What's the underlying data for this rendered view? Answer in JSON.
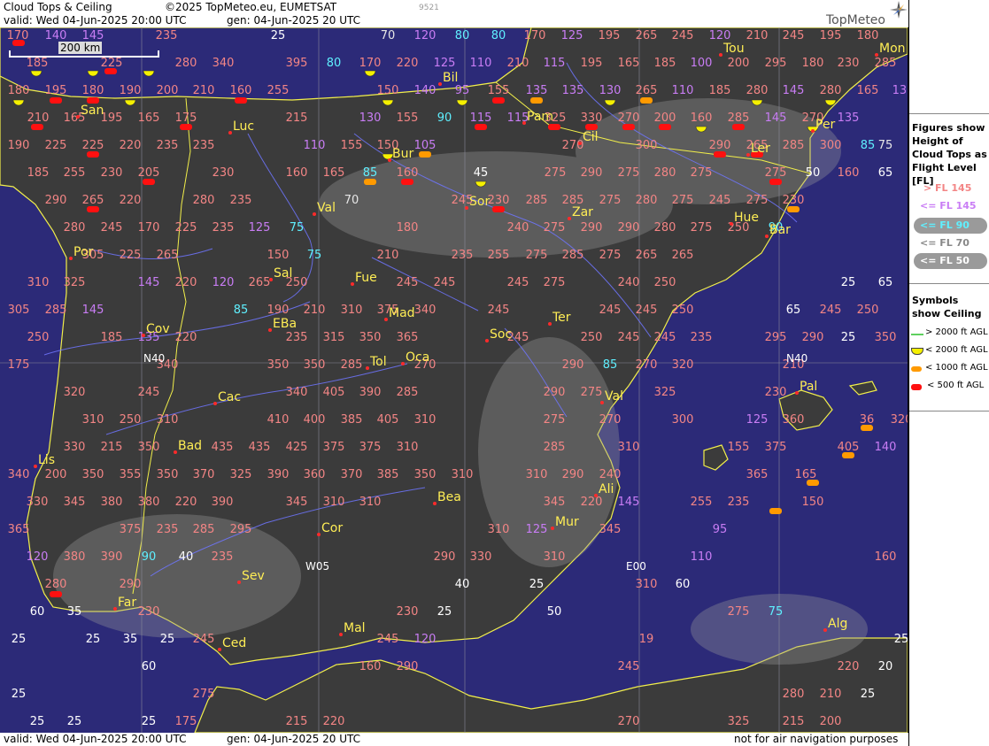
{
  "header": {
    "title": "Cloud Tops & Ceiling",
    "copyright": "©2025 TopMeteo.eu, EUMETSAT",
    "valid": "valid:  Wed  04-Jun-2025  20:00 UTC",
    "generated": "gen: 04-Jun-2025 20 UTC",
    "code": "9521",
    "logo": "TopMeteo"
  },
  "footer": {
    "valid": "valid:  Wed  04-Jun-2025  20:00 UTC",
    "generated": "gen: 04-Jun-2025 20 UTC",
    "disclaimer": "not for air navigation purposes"
  },
  "scale_label": "200 km",
  "legend": {
    "figures_title": "Figures show Height of Cloud Tops as Flight Level  [FL]",
    "figure_items": [
      "> FL 145",
      "<= FL 145",
      "<= FL 90",
      "<= FL 70",
      "<= FL 50"
    ],
    "symbols_title": "Symbols show Ceiling",
    "symbol_items": [
      "> 2000 ft AGL",
      "< 2000 ft AGL",
      "< 1000 ft AGL",
      "< 500 ft AGL"
    ]
  },
  "colors": {
    "sea": "#2c2a78",
    "land": "#3b3b3b",
    "coast": "#f2ef4a",
    "river": "#6f75ff",
    "grid": "#8a8a9a",
    "fl_high": "#f38585",
    "fl_mid": "#c97df5",
    "fl_90": "#5ff0ff",
    "fl_70": "#e6e6e6",
    "fl_50": "#ffffff",
    "ceil_2000": "#f5f000",
    "ceil_1000": "#ff9a00",
    "ceil_500": "#ff1010",
    "city": "#ffee55"
  },
  "grid_labels": [
    "N40",
    "N40",
    "W05",
    "E00"
  ],
  "cities": [
    "Tou",
    "Mon",
    "Bil",
    "San",
    "Pam",
    "Luc",
    "Cil",
    "Per",
    "Ler",
    "Bur",
    "Sor",
    "Zar",
    "Val",
    "Hue",
    "Bar",
    "Por",
    "Sal",
    "Fue",
    "Mad",
    "EBa",
    "Cov",
    "Tol",
    "Oca",
    "Soc",
    "Ter",
    "Pal",
    "Cac",
    "Val",
    "Bad",
    "Lis",
    "Bea",
    "Ali",
    "Mur",
    "Cor",
    "Sev",
    "Far",
    "Mal",
    "Ced",
    "Alg"
  ],
  "flight_levels": [
    {
      "v": "170",
      "c": "a"
    },
    {
      "v": "140",
      "c": "b"
    },
    {
      "v": "145",
      "c": "b"
    },
    {
      "v": "235",
      "c": "a"
    },
    {
      "v": "25",
      "c": "e"
    },
    {
      "v": "70",
      "c": "d"
    },
    {
      "v": "120",
      "c": "b"
    },
    {
      "v": "80",
      "c": "c"
    },
    {
      "v": "80",
      "c": "c"
    },
    {
      "v": "170",
      "c": "a"
    },
    {
      "v": "125",
      "c": "b"
    },
    {
      "v": "195",
      "c": "a"
    },
    {
      "v": "265",
      "c": "a"
    },
    {
      "v": "245",
      "c": "a"
    },
    {
      "v": "120",
      "c": "b"
    },
    {
      "v": "210",
      "c": "a"
    },
    {
      "v": "245",
      "c": "a"
    },
    {
      "v": "195",
      "c": "a"
    },
    {
      "v": "180",
      "c": "a"
    },
    {
      "v": "185",
      "c": "a"
    },
    {
      "v": "225",
      "c": "a"
    },
    {
      "v": "280",
      "c": "a"
    },
    {
      "v": "340",
      "c": "a"
    },
    {
      "v": "395",
      "c": "a"
    },
    {
      "v": "80",
      "c": "c"
    },
    {
      "v": "170",
      "c": "a"
    },
    {
      "v": "220",
      "c": "a"
    },
    {
      "v": "125",
      "c": "b"
    },
    {
      "v": "110",
      "c": "b"
    },
    {
      "v": "210",
      "c": "a"
    },
    {
      "v": "115",
      "c": "b"
    },
    {
      "v": "195",
      "c": "a"
    },
    {
      "v": "165",
      "c": "a"
    },
    {
      "v": "185",
      "c": "a"
    },
    {
      "v": "100",
      "c": "b"
    },
    {
      "v": "200",
      "c": "a"
    },
    {
      "v": "295",
      "c": "a"
    },
    {
      "v": "180",
      "c": "a"
    },
    {
      "v": "230",
      "c": "a"
    },
    {
      "v": "285",
      "c": "a"
    },
    {
      "v": "180",
      "c": "a"
    },
    {
      "v": "195",
      "c": "a"
    },
    {
      "v": "180",
      "c": "a"
    },
    {
      "v": "190",
      "c": "a"
    },
    {
      "v": "200",
      "c": "a"
    },
    {
      "v": "210",
      "c": "a"
    },
    {
      "v": "160",
      "c": "a"
    },
    {
      "v": "255",
      "c": "a"
    },
    {
      "v": "150",
      "c": "a"
    },
    {
      "v": "140",
      "c": "b"
    },
    {
      "v": "95",
      "c": "b"
    },
    {
      "v": "155",
      "c": "a"
    },
    {
      "v": "135",
      "c": "b"
    },
    {
      "v": "135",
      "c": "b"
    },
    {
      "v": "130",
      "c": "b"
    },
    {
      "v": "265",
      "c": "a"
    },
    {
      "v": "110",
      "c": "b"
    },
    {
      "v": "185",
      "c": "a"
    },
    {
      "v": "280",
      "c": "a"
    },
    {
      "v": "145",
      "c": "b"
    },
    {
      "v": "280",
      "c": "a"
    },
    {
      "v": "165",
      "c": "a"
    },
    {
      "v": "135",
      "c": "b"
    },
    {
      "v": "210",
      "c": "a"
    },
    {
      "v": "165",
      "c": "a"
    },
    {
      "v": "195",
      "c": "a"
    },
    {
      "v": "165",
      "c": "a"
    },
    {
      "v": "175",
      "c": "a"
    },
    {
      "v": "215",
      "c": "a"
    },
    {
      "v": "130",
      "c": "b"
    },
    {
      "v": "155",
      "c": "a"
    },
    {
      "v": "90",
      "c": "c"
    },
    {
      "v": "115",
      "c": "b"
    },
    {
      "v": "115",
      "c": "b"
    },
    {
      "v": "325",
      "c": "a"
    },
    {
      "v": "330",
      "c": "a"
    },
    {
      "v": "270",
      "c": "a"
    },
    {
      "v": "200",
      "c": "a"
    },
    {
      "v": "160",
      "c": "a"
    },
    {
      "v": "285",
      "c": "a"
    },
    {
      "v": "145",
      "c": "b"
    },
    {
      "v": "270",
      "c": "a"
    },
    {
      "v": "135",
      "c": "b"
    },
    {
      "v": "190",
      "c": "a"
    },
    {
      "v": "225",
      "c": "a"
    },
    {
      "v": "225",
      "c": "a"
    },
    {
      "v": "220",
      "c": "a"
    },
    {
      "v": "235",
      "c": "a"
    },
    {
      "v": "235",
      "c": "a"
    },
    {
      "v": "110",
      "c": "b"
    },
    {
      "v": "155",
      "c": "a"
    },
    {
      "v": "150",
      "c": "a"
    },
    {
      "v": "105",
      "c": "b"
    },
    {
      "v": "270",
      "c": "a"
    },
    {
      "v": "300",
      "c": "a"
    },
    {
      "v": "290",
      "c": "a"
    },
    {
      "v": "265",
      "c": "a"
    },
    {
      "v": "285",
      "c": "a"
    },
    {
      "v": "300",
      "c": "a"
    },
    {
      "v": "85",
      "c": "c"
    },
    {
      "v": "75",
      "c": "d"
    },
    {
      "v": "185",
      "c": "a"
    },
    {
      "v": "255",
      "c": "a"
    },
    {
      "v": "230",
      "c": "a"
    },
    {
      "v": "205",
      "c": "a"
    },
    {
      "v": "230",
      "c": "a"
    },
    {
      "v": "160",
      "c": "a"
    },
    {
      "v": "165",
      "c": "a"
    },
    {
      "v": "85",
      "c": "c"
    },
    {
      "v": "160",
      "c": "a"
    },
    {
      "v": "45",
      "c": "e"
    },
    {
      "v": "275",
      "c": "a"
    },
    {
      "v": "290",
      "c": "a"
    },
    {
      "v": "275",
      "c": "a"
    },
    {
      "v": "280",
      "c": "a"
    },
    {
      "v": "275",
      "c": "a"
    },
    {
      "v": "275",
      "c": "a"
    },
    {
      "v": "50",
      "c": "e"
    },
    {
      "v": "160",
      "c": "a"
    },
    {
      "v": "65",
      "c": "e"
    },
    {
      "v": "290",
      "c": "a"
    },
    {
      "v": "265",
      "c": "a"
    },
    {
      "v": "220",
      "c": "a"
    },
    {
      "v": "280",
      "c": "a"
    },
    {
      "v": "235",
      "c": "a"
    },
    {
      "v": "70",
      "c": "d"
    },
    {
      "v": "245",
      "c": "a"
    },
    {
      "v": "230",
      "c": "a"
    },
    {
      "v": "285",
      "c": "a"
    },
    {
      "v": "285",
      "c": "a"
    },
    {
      "v": "275",
      "c": "a"
    },
    {
      "v": "280",
      "c": "a"
    },
    {
      "v": "275",
      "c": "a"
    },
    {
      "v": "245",
      "c": "a"
    },
    {
      "v": "275",
      "c": "a"
    },
    {
      "v": "230",
      "c": "a"
    },
    {
      "v": "280",
      "c": "a"
    },
    {
      "v": "245",
      "c": "a"
    },
    {
      "v": "170",
      "c": "a"
    },
    {
      "v": "225",
      "c": "a"
    },
    {
      "v": "235",
      "c": "a"
    },
    {
      "v": "125",
      "c": "b"
    },
    {
      "v": "75",
      "c": "c"
    },
    {
      "v": "180",
      "c": "a"
    },
    {
      "v": "240",
      "c": "a"
    },
    {
      "v": "275",
      "c": "a"
    },
    {
      "v": "290",
      "c": "a"
    },
    {
      "v": "290",
      "c": "a"
    },
    {
      "v": "280",
      "c": "a"
    },
    {
      "v": "275",
      "c": "a"
    },
    {
      "v": "250",
      "c": "a"
    },
    {
      "v": "90",
      "c": "c"
    },
    {
      "v": "305",
      "c": "a"
    },
    {
      "v": "225",
      "c": "a"
    },
    {
      "v": "265",
      "c": "a"
    },
    {
      "v": "150",
      "c": "a"
    },
    {
      "v": "75",
      "c": "c"
    },
    {
      "v": "210",
      "c": "a"
    },
    {
      "v": "235",
      "c": "a"
    },
    {
      "v": "255",
      "c": "a"
    },
    {
      "v": "275",
      "c": "a"
    },
    {
      "v": "285",
      "c": "a"
    },
    {
      "v": "275",
      "c": "a"
    },
    {
      "v": "265",
      "c": "a"
    },
    {
      "v": "265",
      "c": "a"
    },
    {
      "v": "310",
      "c": "a"
    },
    {
      "v": "325",
      "c": "a"
    },
    {
      "v": "145",
      "c": "b"
    },
    {
      "v": "220",
      "c": "a"
    },
    {
      "v": "120",
      "c": "b"
    },
    {
      "v": "265",
      "c": "a"
    },
    {
      "v": "250",
      "c": "a"
    },
    {
      "v": "245",
      "c": "a"
    },
    {
      "v": "245",
      "c": "a"
    },
    {
      "v": "245",
      "c": "a"
    },
    {
      "v": "275",
      "c": "a"
    },
    {
      "v": "240",
      "c": "a"
    },
    {
      "v": "250",
      "c": "a"
    },
    {
      "v": "25",
      "c": "e"
    },
    {
      "v": "65",
      "c": "e"
    },
    {
      "v": "305",
      "c": "a"
    },
    {
      "v": "285",
      "c": "a"
    },
    {
      "v": "145",
      "c": "b"
    },
    {
      "v": "85",
      "c": "c"
    },
    {
      "v": "190",
      "c": "a"
    },
    {
      "v": "210",
      "c": "a"
    },
    {
      "v": "310",
      "c": "a"
    },
    {
      "v": "375",
      "c": "a"
    },
    {
      "v": "340",
      "c": "a"
    },
    {
      "v": "245",
      "c": "a"
    },
    {
      "v": "245",
      "c": "a"
    },
    {
      "v": "245",
      "c": "a"
    },
    {
      "v": "250",
      "c": "a"
    },
    {
      "v": "65",
      "c": "e"
    },
    {
      "v": "245",
      "c": "a"
    },
    {
      "v": "250",
      "c": "a"
    },
    {
      "v": "250",
      "c": "a"
    },
    {
      "v": "185",
      "c": "a"
    },
    {
      "v": "135",
      "c": "b"
    },
    {
      "v": "220",
      "c": "a"
    },
    {
      "v": "235",
      "c": "a"
    },
    {
      "v": "315",
      "c": "a"
    },
    {
      "v": "350",
      "c": "a"
    },
    {
      "v": "365",
      "c": "a"
    },
    {
      "v": "245",
      "c": "a"
    },
    {
      "v": "250",
      "c": "a"
    },
    {
      "v": "245",
      "c": "a"
    },
    {
      "v": "245",
      "c": "a"
    },
    {
      "v": "235",
      "c": "a"
    },
    {
      "v": "295",
      "c": "a"
    },
    {
      "v": "290",
      "c": "a"
    },
    {
      "v": "25",
      "c": "e"
    },
    {
      "v": "350",
      "c": "a"
    },
    {
      "v": "175",
      "c": "a"
    },
    {
      "v": "340",
      "c": "a"
    },
    {
      "v": "350",
      "c": "a"
    },
    {
      "v": "350",
      "c": "a"
    },
    {
      "v": "285",
      "c": "a"
    },
    {
      "v": "270",
      "c": "a"
    },
    {
      "v": "290",
      "c": "a"
    },
    {
      "v": "85",
      "c": "c"
    },
    {
      "v": "270",
      "c": "a"
    },
    {
      "v": "320",
      "c": "a"
    },
    {
      "v": "210",
      "c": "a"
    },
    {
      "v": "320",
      "c": "a"
    },
    {
      "v": "245",
      "c": "a"
    },
    {
      "v": "340",
      "c": "a"
    },
    {
      "v": "405",
      "c": "a"
    },
    {
      "v": "390",
      "c": "a"
    },
    {
      "v": "285",
      "c": "a"
    },
    {
      "v": "290",
      "c": "a"
    },
    {
      "v": "275",
      "c": "a"
    },
    {
      "v": "325",
      "c": "a"
    },
    {
      "v": "230",
      "c": "a"
    },
    {
      "v": "310",
      "c": "a"
    },
    {
      "v": "250",
      "c": "a"
    },
    {
      "v": "310",
      "c": "a"
    },
    {
      "v": "410",
      "c": "a"
    },
    {
      "v": "400",
      "c": "a"
    },
    {
      "v": "385",
      "c": "a"
    },
    {
      "v": "405",
      "c": "a"
    },
    {
      "v": "310",
      "c": "a"
    },
    {
      "v": "275",
      "c": "a"
    },
    {
      "v": "270",
      "c": "a"
    },
    {
      "v": "300",
      "c": "a"
    },
    {
      "v": "125",
      "c": "b"
    },
    {
      "v": "360",
      "c": "a"
    },
    {
      "v": "36",
      "c": "a"
    },
    {
      "v": "320",
      "c": "a"
    },
    {
      "v": "330",
      "c": "a"
    },
    {
      "v": "215",
      "c": "a"
    },
    {
      "v": "350",
      "c": "a"
    },
    {
      "v": "435",
      "c": "a"
    },
    {
      "v": "435",
      "c": "a"
    },
    {
      "v": "425",
      "c": "a"
    },
    {
      "v": "375",
      "c": "a"
    },
    {
      "v": "375",
      "c": "a"
    },
    {
      "v": "310",
      "c": "a"
    },
    {
      "v": "285",
      "c": "a"
    },
    {
      "v": "310",
      "c": "a"
    },
    {
      "v": "155",
      "c": "a"
    },
    {
      "v": "375",
      "c": "a"
    },
    {
      "v": "405",
      "c": "a"
    },
    {
      "v": "140",
      "c": "b"
    },
    {
      "v": "340",
      "c": "a"
    },
    {
      "v": "200",
      "c": "a"
    },
    {
      "v": "350",
      "c": "a"
    },
    {
      "v": "355",
      "c": "a"
    },
    {
      "v": "350",
      "c": "a"
    },
    {
      "v": "370",
      "c": "a"
    },
    {
      "v": "325",
      "c": "a"
    },
    {
      "v": "390",
      "c": "a"
    },
    {
      "v": "360",
      "c": "a"
    },
    {
      "v": "370",
      "c": "a"
    },
    {
      "v": "385",
      "c": "a"
    },
    {
      "v": "350",
      "c": "a"
    },
    {
      "v": "310",
      "c": "a"
    },
    {
      "v": "310",
      "c": "a"
    },
    {
      "v": "290",
      "c": "a"
    },
    {
      "v": "240",
      "c": "a"
    },
    {
      "v": "365",
      "c": "a"
    },
    {
      "v": "165",
      "c": "a"
    },
    {
      "v": "330",
      "c": "a"
    },
    {
      "v": "345",
      "c": "a"
    },
    {
      "v": "380",
      "c": "a"
    },
    {
      "v": "380",
      "c": "a"
    },
    {
      "v": "220",
      "c": "a"
    },
    {
      "v": "390",
      "c": "a"
    },
    {
      "v": "345",
      "c": "a"
    },
    {
      "v": "310",
      "c": "a"
    },
    {
      "v": "310",
      "c": "a"
    },
    {
      "v": "345",
      "c": "a"
    },
    {
      "v": "220",
      "c": "a"
    },
    {
      "v": "145",
      "c": "b"
    },
    {
      "v": "255",
      "c": "a"
    },
    {
      "v": "235",
      "c": "a"
    },
    {
      "v": "150",
      "c": "a"
    },
    {
      "v": "365",
      "c": "a"
    },
    {
      "v": "375",
      "c": "a"
    },
    {
      "v": "235",
      "c": "a"
    },
    {
      "v": "285",
      "c": "a"
    },
    {
      "v": "295",
      "c": "a"
    },
    {
      "v": "310",
      "c": "a"
    },
    {
      "v": "125",
      "c": "b"
    },
    {
      "v": "345",
      "c": "a"
    },
    {
      "v": "95",
      "c": "b"
    },
    {
      "v": "120",
      "c": "b"
    },
    {
      "v": "380",
      "c": "a"
    },
    {
      "v": "390",
      "c": "a"
    },
    {
      "v": "90",
      "c": "c"
    },
    {
      "v": "40",
      "c": "e"
    },
    {
      "v": "235",
      "c": "a"
    },
    {
      "v": "290",
      "c": "a"
    },
    {
      "v": "330",
      "c": "a"
    },
    {
      "v": "310",
      "c": "a"
    },
    {
      "v": "110",
      "c": "b"
    },
    {
      "v": "160",
      "c": "a"
    },
    {
      "v": "280",
      "c": "a"
    },
    {
      "v": "290",
      "c": "a"
    },
    {
      "v": "40",
      "c": "e"
    },
    {
      "v": "25",
      "c": "e"
    },
    {
      "v": "310",
      "c": "a"
    },
    {
      "v": "60",
      "c": "e"
    },
    {
      "v": "60",
      "c": "e"
    },
    {
      "v": "35",
      "c": "e"
    },
    {
      "v": "230",
      "c": "a"
    },
    {
      "v": "230",
      "c": "a"
    },
    {
      "v": "25",
      "c": "e"
    },
    {
      "v": "50",
      "c": "e"
    },
    {
      "v": "275",
      "c": "a"
    },
    {
      "v": "75",
      "c": "c"
    },
    {
      "v": "25",
      "c": "e"
    },
    {
      "v": "25",
      "c": "e"
    },
    {
      "v": "35",
      "c": "e"
    },
    {
      "v": "25",
      "c": "e"
    },
    {
      "v": "245",
      "c": "a"
    },
    {
      "v": "245",
      "c": "a"
    },
    {
      "v": "120",
      "c": "b"
    },
    {
      "v": "19",
      "c": "a"
    },
    {
      "v": "25",
      "c": "e"
    },
    {
      "v": "60",
      "c": "e"
    },
    {
      "v": "160",
      "c": "a"
    },
    {
      "v": "290",
      "c": "a"
    },
    {
      "v": "245",
      "c": "a"
    },
    {
      "v": "220",
      "c": "a"
    },
    {
      "v": "20",
      "c": "e"
    },
    {
      "v": "25",
      "c": "e"
    },
    {
      "v": "275",
      "c": "a"
    },
    {
      "v": "280",
      "c": "a"
    },
    {
      "v": "210",
      "c": "a"
    },
    {
      "v": "25",
      "c": "e"
    },
    {
      "v": "25",
      "c": "e"
    },
    {
      "v": "25",
      "c": "e"
    },
    {
      "v": "25",
      "c": "e"
    },
    {
      "v": "175",
      "c": "a"
    },
    {
      "v": "215",
      "c": "a"
    },
    {
      "v": "220",
      "c": "a"
    },
    {
      "v": "270",
      "c": "a"
    },
    {
      "v": "325",
      "c": "a"
    },
    {
      "v": "215",
      "c": "a"
    },
    {
      "v": "200",
      "c": "a"
    }
  ]
}
